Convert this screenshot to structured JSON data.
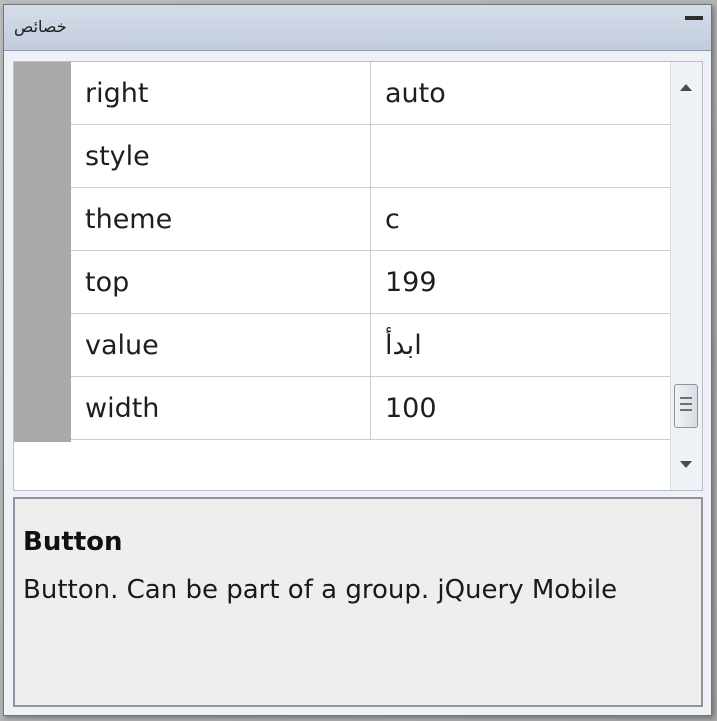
{
  "window": {
    "title": "خصائص"
  },
  "properties": [
    {
      "name": "right",
      "value": "auto"
    },
    {
      "name": "style",
      "value": ""
    },
    {
      "name": "theme",
      "value": "c"
    },
    {
      "name": "top",
      "value": "199"
    },
    {
      "name": "value",
      "value": "ابدأ"
    },
    {
      "name": "width",
      "value": "100"
    }
  ],
  "description": {
    "title": "Button",
    "text": "Button. Can be part of a group. jQuery Mobile"
  },
  "icons": {
    "minimize": "minimize-icon",
    "scroll_up": "scroll-up-arrow-icon",
    "scroll_down": "scroll-down-arrow-icon",
    "thumb_grip": "scroll-grip-icon"
  }
}
